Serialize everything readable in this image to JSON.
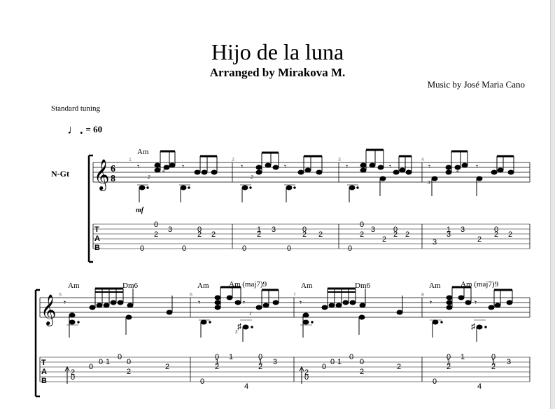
{
  "score": {
    "title": "Hijo de la luna",
    "subtitle": "Arranged by Mirakova M.",
    "composer": "Music by José Maria Cano",
    "tuning": "Standard tuning",
    "tempo": {
      "note_glyph": "♩.",
      "value": "= 60"
    },
    "instrument": "N-Gt",
    "time_signature": {
      "top": "6",
      "bottom": "8"
    },
    "dynamic": "mf",
    "tab_label": [
      "T",
      "A",
      "B"
    ]
  },
  "systems": [
    {
      "measures": [
        {
          "number": "1",
          "chords": [
            "Am"
          ],
          "tab": [
            [
              "0",
              "2",
              "0"
            ],
            [
              "3"
            ],
            [
              "0",
              "2",
              "0"
            ],
            [
              "2"
            ]
          ]
        },
        {
          "number": "2",
          "chords": [],
          "tab": [
            [
              "1",
              "2",
              "0"
            ],
            [
              "3"
            ],
            [
              "0",
              "2",
              "0"
            ],
            [
              "2"
            ]
          ]
        },
        {
          "number": "3",
          "chords": [],
          "tab": [
            [
              "0",
              "2",
              "0"
            ],
            [
              "3"
            ],
            [
              "0",
              "2",
              "2"
            ],
            [
              "2"
            ]
          ]
        },
        {
          "number": "4",
          "chords": [],
          "tab": [
            [
              "1",
              "3"
            ],
            [
              "3"
            ],
            [
              "0",
              "2",
              "2"
            ],
            [
              "2"
            ]
          ]
        }
      ]
    },
    {
      "measures": [
        {
          "number": "5",
          "chords": [
            "Am",
            "Dm6"
          ],
          "tab": [
            [
              "2",
              "0"
            ],
            [
              "0",
              "1"
            ],
            [
              "0",
              "2"
            ],
            [
              "2"
            ]
          ]
        },
        {
          "number": "6",
          "chords": [
            "Am",
            "Am (maj7)9"
          ],
          "tab": [
            [
              "0",
              "1",
              "2",
              "0"
            ],
            [
              "1"
            ],
            [
              "0",
              "2",
              "4"
            ],
            [
              "3"
            ]
          ]
        },
        {
          "number": "7",
          "chords": [
            "Am",
            "Dm6"
          ],
          "tab": [
            [
              "2",
              "0"
            ],
            [
              "0",
              "1"
            ],
            [
              "0",
              "2"
            ],
            [
              "2"
            ]
          ]
        },
        {
          "number": "8",
          "chords": [
            "Am",
            "Am (maj7)9"
          ],
          "tab": [
            [
              "0",
              "1",
              "2",
              "0"
            ],
            [
              "1"
            ],
            [
              "0",
              "2",
              "4"
            ],
            [
              "3"
            ]
          ]
        }
      ]
    }
  ]
}
